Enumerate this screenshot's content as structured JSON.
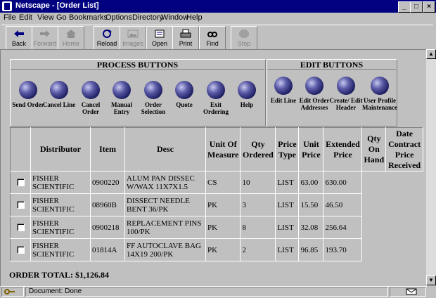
{
  "window": {
    "title": "Netscape - [Order List]"
  },
  "menu": [
    "File",
    "Edit",
    "View",
    "Go",
    "Bookmarks",
    "Options",
    "Directory",
    "Window",
    "Help"
  ],
  "toolbar": [
    {
      "label": "Back",
      "icon": "back-arrow-icon",
      "enabled": true
    },
    {
      "label": "Forward",
      "icon": "forward-arrow-icon",
      "enabled": false
    },
    {
      "label": "Home",
      "icon": "home-icon",
      "enabled": false
    },
    {
      "label": "Reload",
      "icon": "reload-icon",
      "enabled": true
    },
    {
      "label": "Images",
      "icon": "images-icon",
      "enabled": false
    },
    {
      "label": "Open",
      "icon": "open-icon",
      "enabled": true
    },
    {
      "label": "Print",
      "icon": "print-icon",
      "enabled": true
    },
    {
      "label": "Find",
      "icon": "find-icon",
      "enabled": true
    },
    {
      "label": "Stop",
      "icon": "stop-icon",
      "enabled": false
    }
  ],
  "process": {
    "title": "PROCESS BUTTONS",
    "buttons": [
      {
        "label": "Send Order"
      },
      {
        "label": "Cancel Line"
      },
      {
        "label": "Cancel Order"
      },
      {
        "label": "Manual Entry"
      },
      {
        "label": "Order Selection"
      },
      {
        "label": "Quote"
      },
      {
        "label": "Exit Ordering"
      },
      {
        "label": "Help"
      }
    ]
  },
  "edit": {
    "title": "EDIT BUTTONS",
    "buttons": [
      {
        "label": "Edit Line"
      },
      {
        "label": "Edit Order Addresses"
      },
      {
        "label": "Create/ Edit Header"
      },
      {
        "label": "User Profile Maintenance"
      }
    ]
  },
  "table": {
    "headers": [
      "Distributor",
      "Item",
      "Desc",
      "Unit Of Measure",
      "Qty Ordered",
      "Price Type",
      "Unit Price",
      "Extended Price",
      "Qty On Hand",
      "Date Contract Price Received"
    ],
    "rows": [
      {
        "distributor": "FISHER SCIENTIFIC",
        "item": "0900220",
        "desc": "ALUM PAN DISSEC W/WAX 11X7X1.5",
        "uom": "CS",
        "qty": "10",
        "ptype": "LIST",
        "unit": "63.00",
        "ext": "630.00"
      },
      {
        "distributor": "FISHER SCIENTIFIC",
        "item": "08960B",
        "desc": "DISSECT NEEDLE BENT 36/PK",
        "uom": "PK",
        "qty": "3",
        "ptype": "LIST",
        "unit": "15.50",
        "ext": "46.50"
      },
      {
        "distributor": "FISHER SCIENTIFIC",
        "item": "0900218",
        "desc": "REPLACEMENT PINS 100/PK",
        "uom": "PK",
        "qty": "8",
        "ptype": "LIST",
        "unit": "32.08",
        "ext": "256.64"
      },
      {
        "distributor": "FISHER SCIENTIFIC",
        "item": "01814A",
        "desc": "FF AUTOCLAVE BAG 14X19 200/PK",
        "uom": "PK",
        "qty": "2",
        "ptype": "LIST",
        "unit": "96.85",
        "ext": "193.70"
      }
    ]
  },
  "order_total": "ORDER TOTAL: $1,126.84",
  "status": {
    "text": "Document: Done"
  }
}
